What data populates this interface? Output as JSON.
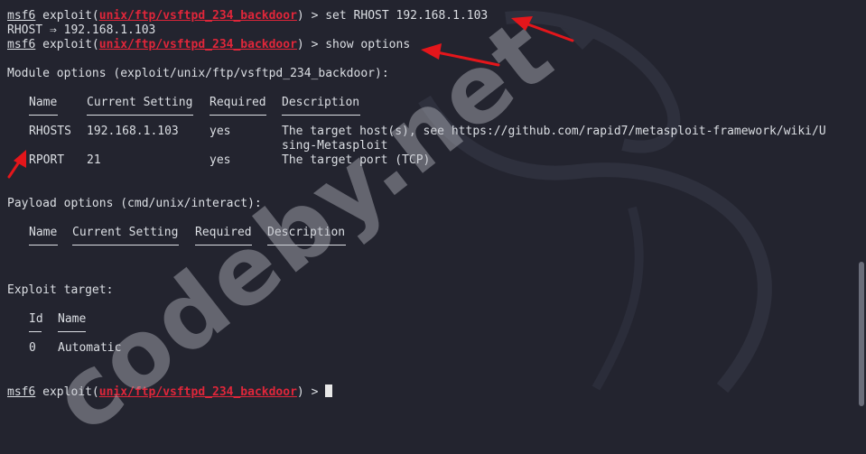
{
  "prompt": {
    "app": "msf6",
    "exploit_prefix": " exploit(",
    "module": "unix/ftp/vsftpd_234_backdoor",
    "suffix": ") > "
  },
  "commands": {
    "set_rhost": "set RHOST 192.168.1.103",
    "show_options": "show options"
  },
  "set_result": "RHOST ⇒ 192.168.1.103",
  "module_options": {
    "heading": "Module options (exploit/unix/ftp/vsftpd_234_backdoor):",
    "columns": [
      "Name",
      "Current Setting",
      "Required",
      "Description"
    ],
    "rows": [
      {
        "name": "RHOSTS",
        "setting": "192.168.1.103",
        "required": "yes",
        "description": "The target host(s), see https://github.com/rapid7/metasploit-framework/wiki/U",
        "description_cont": "sing-Metasploit"
      },
      {
        "name": "RPORT",
        "setting": "21",
        "required": "yes",
        "description": "The target port (TCP)"
      }
    ]
  },
  "payload_options": {
    "heading": "Payload options (cmd/unix/interact):",
    "columns": [
      "Name",
      "Current Setting",
      "Required",
      "Description"
    ]
  },
  "exploit_target": {
    "heading": "Exploit target:",
    "columns": [
      "Id",
      "Name"
    ],
    "rows": [
      {
        "id": "0",
        "name": "Automatic"
      }
    ]
  },
  "watermark": "codeby.net",
  "colors": {
    "background": "#23242f",
    "text": "#dcdfe4",
    "module": "#e0263a",
    "arrow": "#e4161b"
  }
}
